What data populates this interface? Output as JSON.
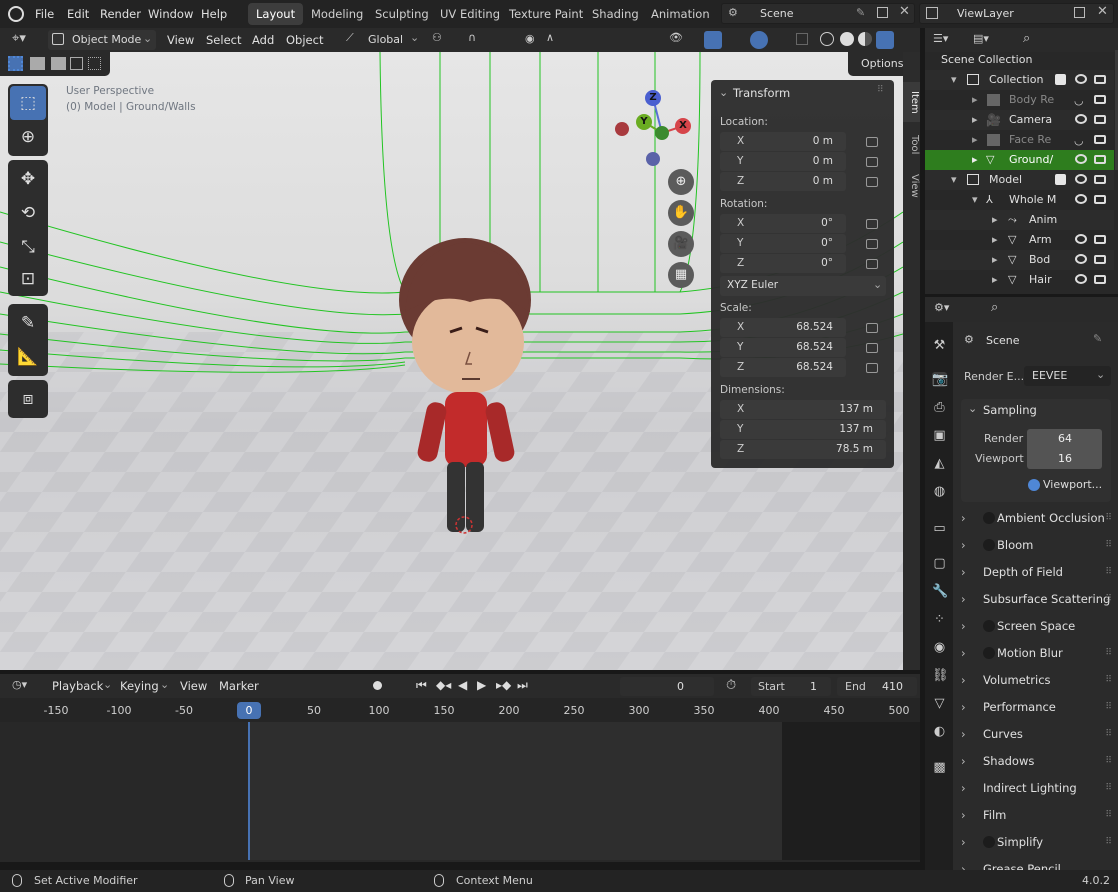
{
  "topbar": {
    "menus": [
      "File",
      "Edit",
      "Render",
      "Window",
      "Help"
    ],
    "workspaces": [
      "Layout",
      "Modeling",
      "Sculpting",
      "UV Editing",
      "Texture Paint",
      "Shading",
      "Animation"
    ],
    "active_workspace": "Layout",
    "scene_name": "Scene",
    "view_layer": "ViewLayer"
  },
  "viewport": {
    "mode": "Object Mode",
    "menus": [
      "View",
      "Select",
      "Add",
      "Object"
    ],
    "orientation": "Global",
    "options_label": "Options",
    "overlay_text_1": "User Perspective",
    "overlay_text_2": "(0) Model | Ground/Walls",
    "gizmo": {
      "x": "X",
      "y": "Y",
      "z": "Z"
    },
    "side_tabs": [
      "Item",
      "Tool",
      "View"
    ]
  },
  "transform_panel": {
    "title": "Transform",
    "location_label": "Location:",
    "location": [
      {
        "axis": "X",
        "value": "0 m"
      },
      {
        "axis": "Y",
        "value": "0 m"
      },
      {
        "axis": "Z",
        "value": "0 m"
      }
    ],
    "rotation_label": "Rotation:",
    "rotation": [
      {
        "axis": "X",
        "value": "0°"
      },
      {
        "axis": "Y",
        "value": "0°"
      },
      {
        "axis": "Z",
        "value": "0°"
      }
    ],
    "rotation_mode": "XYZ Euler",
    "scale_label": "Scale:",
    "scale": [
      {
        "axis": "X",
        "value": "68.524"
      },
      {
        "axis": "Y",
        "value": "68.524"
      },
      {
        "axis": "Z",
        "value": "68.524"
      }
    ],
    "dimensions_label": "Dimensions:",
    "dimensions": [
      {
        "axis": "X",
        "value": "137 m"
      },
      {
        "axis": "Y",
        "value": "137 m"
      },
      {
        "axis": "Z",
        "value": "78.5 m"
      }
    ]
  },
  "timeline": {
    "menus": [
      "Playback",
      "Keying",
      "View",
      "Marker"
    ],
    "current_frame": "0",
    "start_label": "Start",
    "start": "1",
    "end_label": "End",
    "end": "410",
    "ruler_ticks": [
      "-150",
      "-100",
      "-50",
      "0",
      "50",
      "100",
      "150",
      "200",
      "250",
      "300",
      "350",
      "400",
      "450",
      "500"
    ]
  },
  "outliner": {
    "rows": [
      {
        "label": "Scene Collection"
      },
      {
        "label": "Collection"
      },
      {
        "label": "Body Re"
      },
      {
        "label": "Camera"
      },
      {
        "label": "Face Re"
      },
      {
        "label": "Ground/"
      },
      {
        "label": "Model"
      },
      {
        "label": "Whole M"
      },
      {
        "label": "Anim"
      },
      {
        "label": "Arm"
      },
      {
        "label": "Bod"
      },
      {
        "label": "Hair"
      }
    ]
  },
  "properties": {
    "context": "Scene",
    "render_engine_label": "Render E...",
    "render_engine": "EEVEE",
    "sampling_title": "Sampling",
    "render_label": "Render",
    "render_samples": "64",
    "viewport_label": "Viewport",
    "viewport_samples": "16",
    "viewport_denoise": "Viewport...",
    "sections": [
      "Ambient Occlusion",
      "Bloom",
      "Depth of Field",
      "Subsurface Scattering",
      "Screen Space Reflecti",
      "Motion Blur",
      "Volumetrics",
      "Performance",
      "Curves",
      "Shadows",
      "Indirect Lighting",
      "Film",
      "Simplify",
      "Grease Pencil"
    ]
  },
  "statusbar": {
    "hint_left": "Set Active Modifier",
    "hint_middle": "Pan View",
    "hint_right": "Context Menu",
    "version": "4.0.2"
  },
  "colors": {
    "accent": "#4772b3",
    "selected": "#2e7d1e",
    "active_frame": "#4772b3"
  }
}
